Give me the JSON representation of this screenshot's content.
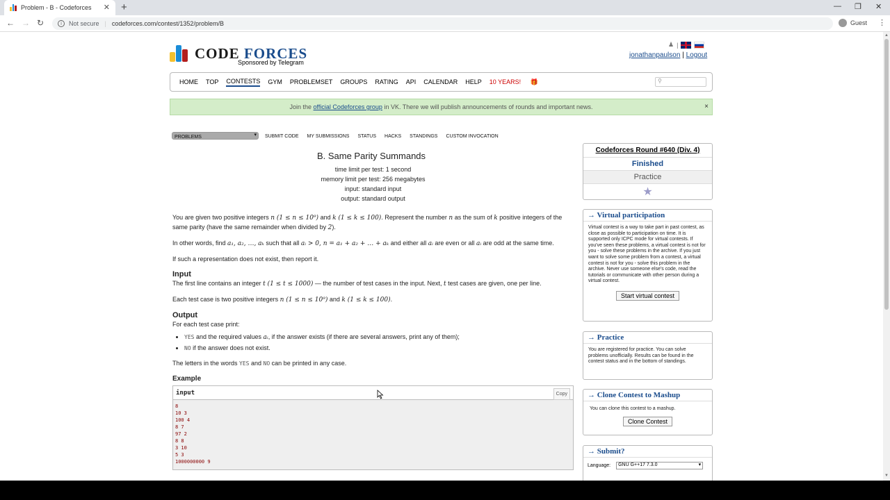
{
  "browser": {
    "tab_title": "Problem - B - Codeforces",
    "not_secure": "Not secure",
    "url": "codeforces.com/contest/1352/problem/B",
    "profile": "Guest"
  },
  "header": {
    "logo_code": "CODE",
    "logo_forces": "FORCES",
    "sponsor": "Sponsored by Telegram",
    "username": "jonathanpaulson",
    "logout": "Logout"
  },
  "menu": {
    "items": [
      "HOME",
      "TOP",
      "CONTESTS",
      "GYM",
      "PROBLEMSET",
      "GROUPS",
      "RATING",
      "API",
      "CALENDAR",
      "HELP",
      "10 YEARS!"
    ],
    "active": "CONTESTS"
  },
  "notice": {
    "pre": "Join the ",
    "link": "official Codeforces group",
    "post": " in VK. There we will publish announcements of rounds and important news.",
    "close": "×"
  },
  "subtabs": [
    "PROBLEMS",
    "SUBMIT CODE",
    "MY SUBMISSIONS",
    "STATUS",
    "HACKS",
    "STANDINGS",
    "CUSTOM INVOCATION"
  ],
  "problem": {
    "title": "B. Same Parity Summands",
    "time_limit": "time limit per test: 1 second",
    "memory_limit": "memory limit per test: 256 megabytes",
    "input": "input: standard input",
    "output": "output: standard output",
    "p1a": "You are given two positive integers ",
    "p1b": " and ",
    "p1c": ". Represent the number ",
    "p1d": " as the sum of ",
    "p1e": " positive integers of the same parity (have the same remainder when divided by ",
    "p1f": ").",
    "p2a": "In other words, find ",
    "p2b": " such that all ",
    "p2c": " and either all ",
    "p2d": " are even or all ",
    "p2e": " are odd at the same time.",
    "p3": "If such a representation does not exist, then report it.",
    "input_title": "Input",
    "in1a": "The first line contains an integer ",
    "in1b": " — the number of test cases in the input. Next, ",
    "in1c": " test cases are given, one per line.",
    "in2a": "Each test case is two positive integers ",
    "in2b": " and ",
    "in2c": ".",
    "output_title": "Output",
    "out1": "For each test case print:",
    "li1a": "YES",
    "li1b": " and the required values ",
    "li1c": ", if the answer exists (if there are several answers, print any of them);",
    "li2a": "NO",
    "li2b": " if the answer does not exist.",
    "out2a": "The letters in the words ",
    "out2b": "YES",
    "out2c": " and ",
    "out2d": "NO",
    "out2e": " can be printed in any case.",
    "example_title": "Example",
    "sample_input_label": "input",
    "copy": "Copy",
    "sample_input": [
      "8",
      "10 3",
      "100 4",
      "8 7",
      "97 2",
      "8 8",
      "3 10",
      "5 3",
      "1000000000 9"
    ],
    "math": {
      "n_range": "n (1 ≤ n ≤ 10⁹)",
      "k_range": "k (1 ≤ k ≤ 100)",
      "n": "n",
      "k": "k",
      "two": "2",
      "as": "a₁, a₂, …, aₖ",
      "cond": "aᵢ > 0, n = a₁ + a₂ + … + aₖ",
      "ai": "aᵢ",
      "t_range": "t (1 ≤ t ≤ 1000)",
      "t": "t"
    }
  },
  "sidebar": {
    "round_name": "Codeforces Round #640 (Div. 4)",
    "finished": "Finished",
    "practice": "Practice",
    "star": "★",
    "virtual_title": "→ Virtual participation",
    "virtual_text": "Virtual contest is a way to take part in past contest, as close as possible to participation on time. It is supported only ICPC mode for virtual contests. If you've seen these problems, a virtual contest is not for you - solve these problems in the archive. If you just want to solve some problem from a contest, a virtual contest is not for you - solve this problem in the archive. Never use someone else's code, read the tutorials or communicate with other person during a virtual contest.",
    "virtual_button": "Start virtual contest",
    "practice_title": "→ Practice",
    "practice_text": "You are registered for practice. You can solve problems unofficially. Results can be found in the contest status and in the bottom of standings.",
    "clone_title": "→ Clone Contest to Mashup",
    "clone_text": "You can clone this contest to a mashup.",
    "clone_button": "Clone Contest",
    "submit_title": "→ Submit?",
    "language_label": "Language:",
    "language_value": "GNU G++17 7.3.0"
  }
}
